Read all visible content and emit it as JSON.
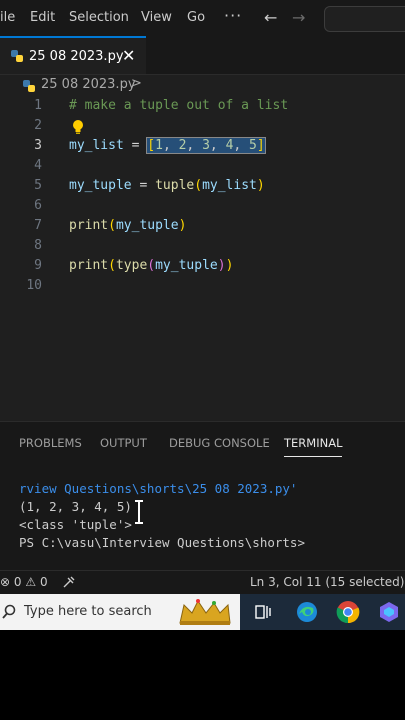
{
  "menu": {
    "items": [
      "ile",
      "Edit",
      "Selection",
      "View",
      "Go"
    ],
    "more": "···"
  },
  "tab": {
    "label": "25 08 2023.py",
    "close": "✕"
  },
  "breadcrumb": {
    "file": "25 08 2023.py",
    "separator": ">"
  },
  "editor": {
    "line_numbers": [
      "1",
      "2",
      "3",
      "4",
      "5",
      "6",
      "7",
      "8",
      "9",
      "10"
    ],
    "comment": "# make a tuple out of a list",
    "active_line": "3"
  },
  "panel": {
    "tabs": [
      "PROBLEMS",
      "OUTPUT",
      "DEBUG CONSOLE",
      "TERMINAL"
    ],
    "active_tab": "TERMINAL",
    "terminal_lines": [
      "rview Questions\\shorts\\25 08 2023.py'",
      "(1, 2, 3, 4, 5)",
      "<class 'tuple'>",
      "PS C:\\vasu\\Interview Questions\\shorts>"
    ]
  },
  "status": {
    "errors": "0",
    "warnings": "0",
    "position": "Ln 3, Col 11 (15 selected)"
  },
  "taskbar": {
    "search_placeholder": "Type here to search"
  },
  "colors": {
    "accent": "#0078d4",
    "editor_bg": "#1f1f1f",
    "selection": "#264f78"
  }
}
